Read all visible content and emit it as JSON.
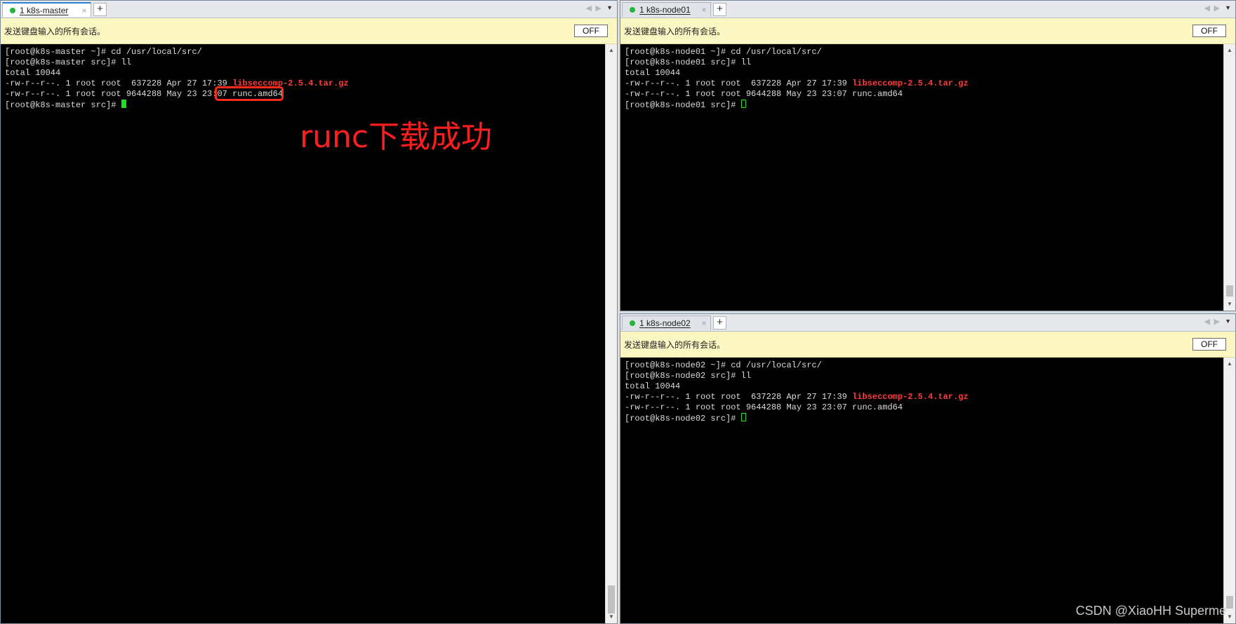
{
  "panes": {
    "master": {
      "tab": {
        "number": "1",
        "name": "k8s-master",
        "close": "×",
        "add": "+"
      },
      "sendbar": {
        "text": "发送键盘输入的所有会话。",
        "toggle": "OFF"
      },
      "lines": [
        "[root@k8s-master ~]# cd /usr/local/src/",
        "[root@k8s-master src]# ll",
        "total 10044",
        "-rw-r--r--. 1 root root  637228 Apr 27 17:39 ",
        "-rw-r--r--. 1 root root 9644288 May 23 23:07 runc.amd64",
        "[root@k8s-master src]# "
      ],
      "file_highlight": "libseccomp-2.5.4.tar.gz"
    },
    "node01": {
      "tab": {
        "number": "1",
        "name": "k8s-node01",
        "close": "×",
        "add": "+"
      },
      "sendbar": {
        "text": "发送键盘输入的所有会话。",
        "toggle": "OFF"
      },
      "lines": [
        "[root@k8s-node01 ~]# cd /usr/local/src/",
        "[root@k8s-node01 src]# ll",
        "total 10044",
        "-rw-r--r--. 1 root root  637228 Apr 27 17:39 ",
        "-rw-r--r--. 1 root root 9644288 May 23 23:07 runc.amd64",
        "[root@k8s-node01 src]# "
      ],
      "file_highlight": "libseccomp-2.5.4.tar.gz"
    },
    "node02": {
      "tab": {
        "number": "1",
        "name": "k8s-node02",
        "close": "×",
        "add": "+"
      },
      "sendbar": {
        "text": "发送键盘输入的所有会话。",
        "toggle": "OFF"
      },
      "lines": [
        "[root@k8s-node02 ~]# cd /usr/local/src/",
        "[root@k8s-node02 src]# ll",
        "total 10044",
        "-rw-r--r--. 1 root root  637228 Apr 27 17:39 ",
        "-rw-r--r--. 1 root root 9644288 May 23 23:07 runc.amd64",
        "[root@k8s-node02 src]# "
      ],
      "file_highlight": "libseccomp-2.5.4.tar.gz"
    }
  },
  "annotation": {
    "text": "runc下载成功",
    "color": "#ff1e1e"
  },
  "watermark": "CSDN @XiaoHH Superme",
  "colors": {
    "active_tab_accent": "#2b7fd8",
    "status_dot": "#25b33a",
    "sendbar_bg": "#fcf6c3",
    "terminal_bg": "#000000",
    "cursor": "#1ee11e",
    "archive_file": "#ff3b3b"
  },
  "icons": [
    "status-dot-icon",
    "close-icon",
    "add-tab-icon",
    "nav-left-icon",
    "nav-right-icon",
    "dropdown-icon",
    "scroll-up-icon",
    "scroll-down-icon"
  ]
}
